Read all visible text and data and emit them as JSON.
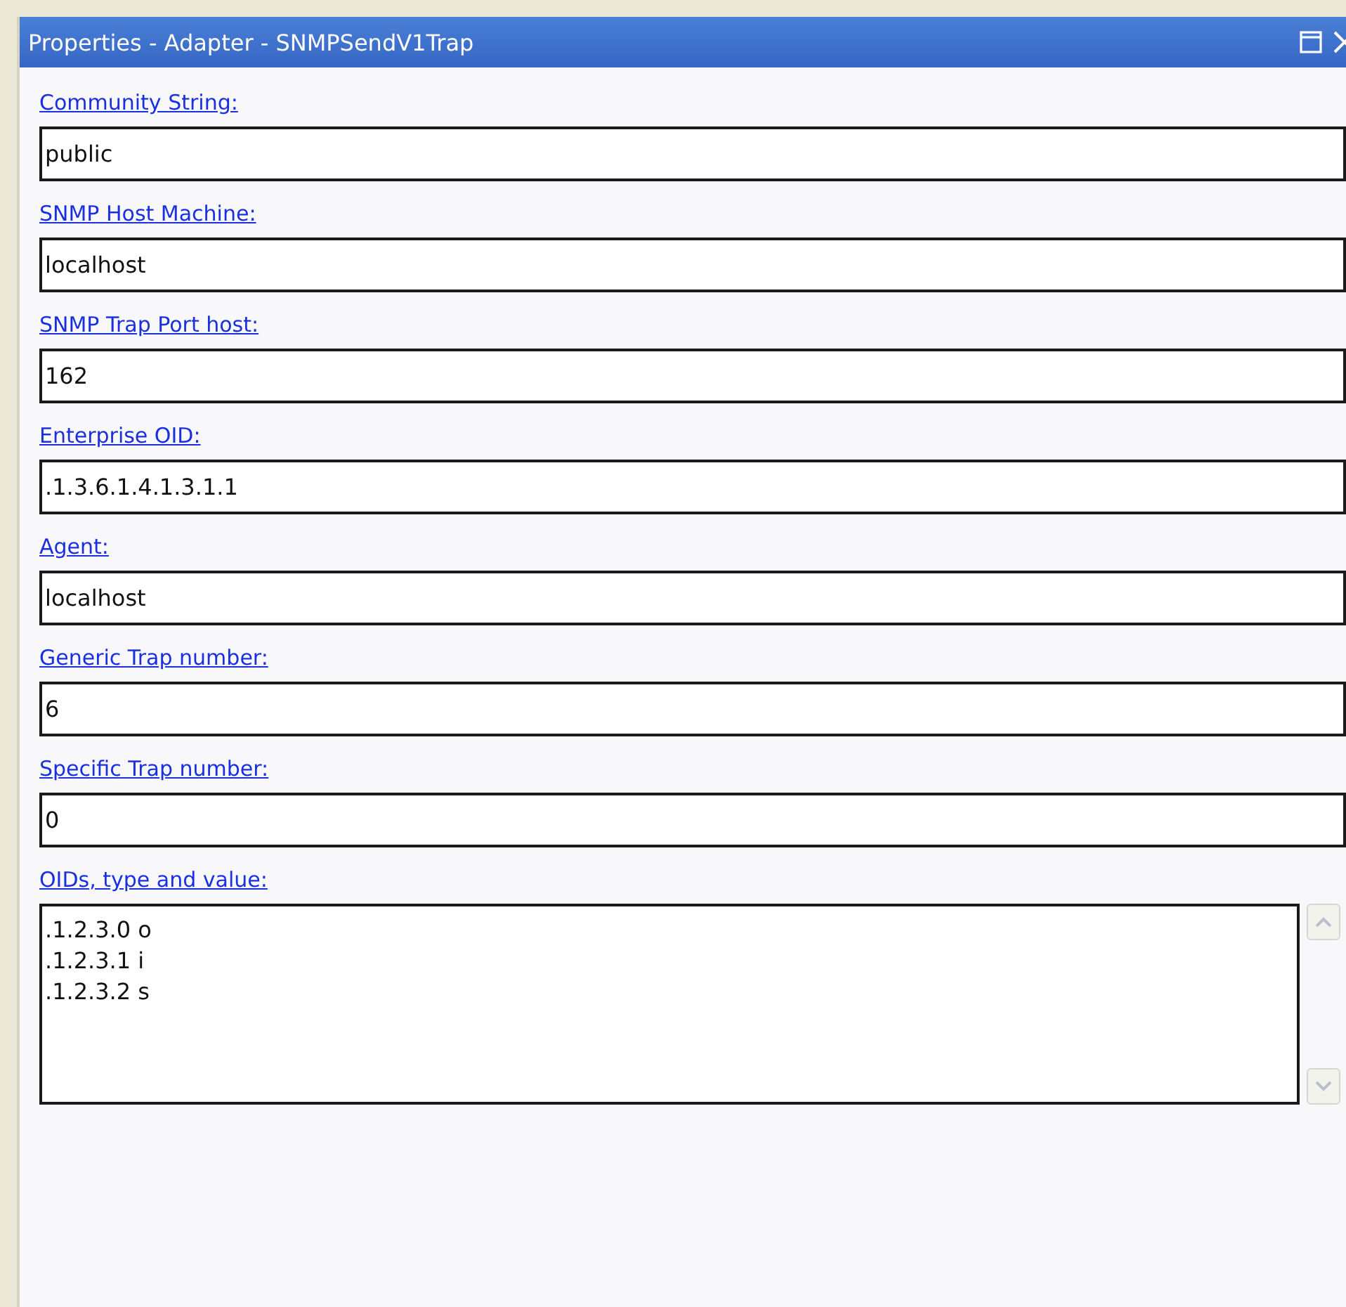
{
  "window": {
    "title": "Properties - Adapter - SNMPSendV1Trap"
  },
  "fields": [
    {
      "label": "Community String:",
      "value": "public"
    },
    {
      "label": "SNMP Host Machine:",
      "value": "localhost"
    },
    {
      "label": "SNMP Trap Port host:",
      "value": "162"
    },
    {
      "label": "Enterprise OID:",
      "value": ".1.3.6.1.4.1.3.1.1"
    },
    {
      "label": "Agent:",
      "value": "localhost"
    },
    {
      "label": "Generic Trap number:",
      "value": "6"
    },
    {
      "label": "Specific Trap number:",
      "value": "0"
    }
  ],
  "oids": {
    "label": "OIDs, type and value:",
    "lines": [
      ".1.2.3.0 o",
      ".1.2.3.1 i",
      ".1.2.3.2 s"
    ]
  }
}
